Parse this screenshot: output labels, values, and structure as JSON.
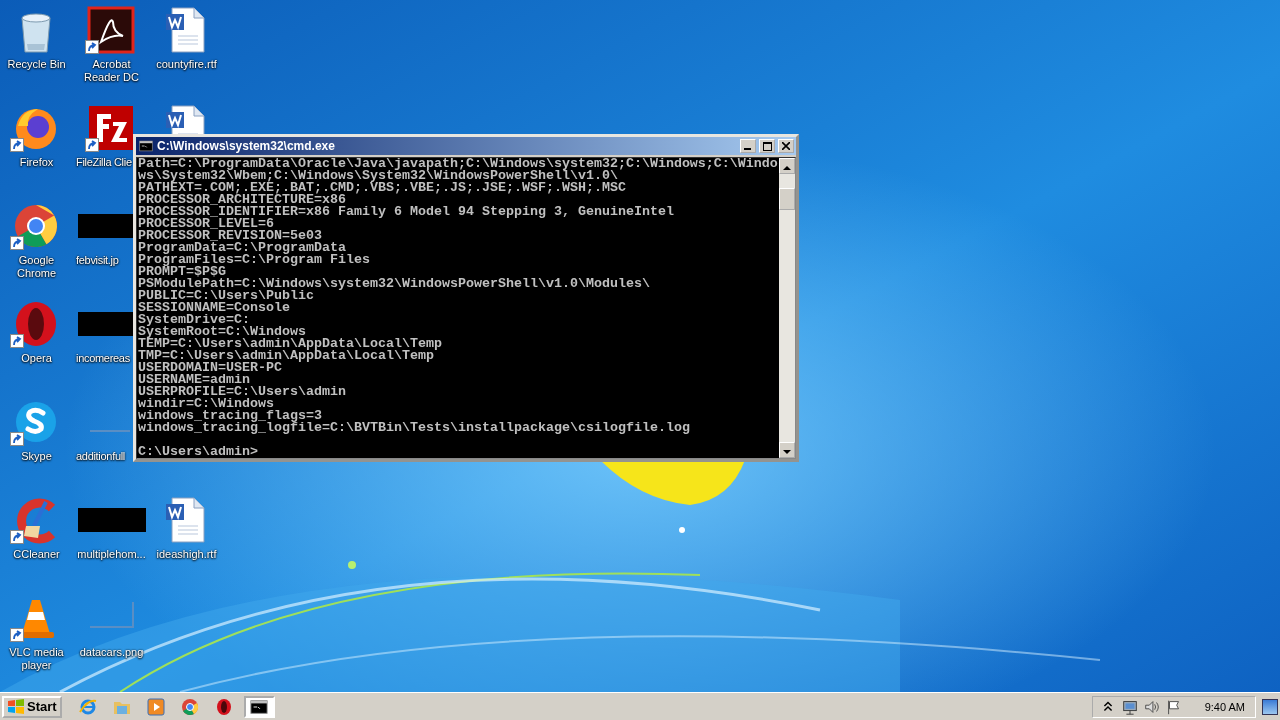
{
  "desktop": {
    "icon_columns": [
      [
        {
          "label": "Recycle Bin",
          "kind": "recycle-bin",
          "shortcut": false
        },
        {
          "label": "Firefox",
          "kind": "firefox",
          "shortcut": true
        },
        {
          "label": "Google\nChrome",
          "kind": "chrome",
          "shortcut": true
        },
        {
          "label": "Opera",
          "kind": "opera",
          "shortcut": true
        },
        {
          "label": "Skype",
          "kind": "skype",
          "shortcut": true
        },
        {
          "label": "CCleaner",
          "kind": "ccleaner",
          "shortcut": true
        },
        {
          "label": "VLC media\nplayer",
          "kind": "vlc",
          "shortcut": true
        }
      ],
      [
        {
          "label": "Acrobat\nReader DC",
          "kind": "acrobat",
          "shortcut": true
        },
        {
          "label": "FileZilla Clie",
          "kind": "filezilla",
          "shortcut": true
        },
        {
          "label": "febvisit.jp",
          "kind": "dark-thumbnail",
          "shortcut": false
        },
        {
          "label": "incomereas",
          "kind": "dark-thumbnail",
          "shortcut": false
        },
        {
          "label": "additionfull",
          "kind": "blank-thumbnail",
          "shortcut": false
        },
        {
          "label": "multiplehom...",
          "kind": "dark-thumbnail",
          "shortcut": false
        },
        {
          "label": "datacars.png",
          "kind": "blank-thumbnail",
          "shortcut": false
        }
      ],
      [
        {
          "label": "countyfire.rtf",
          "kind": "word-doc",
          "shortcut": false
        },
        {
          "kind": "word-doc",
          "shortcut": false
        },
        {
          "label": "ideashigh.rtf",
          "kind": "word-doc",
          "shortcut": false
        }
      ]
    ]
  },
  "console_window": {
    "title": "C:\\Windows\\system32\\cmd.exe",
    "lines": [
      "Path=C:\\ProgramData\\Oracle\\Java\\javapath;C:\\Windows\\system32;C:\\Windows;C:\\Windo",
      "ws\\System32\\Wbem;C:\\Windows\\System32\\WindowsPowerShell\\v1.0\\",
      "PATHEXT=.COM;.EXE;.BAT;.CMD;.VBS;.VBE;.JS;.JSE;.WSF;.WSH;.MSC",
      "PROCESSOR_ARCHITECTURE=x86",
      "PROCESSOR_IDENTIFIER=x86 Family 6 Model 94 Stepping 3, GenuineIntel",
      "PROCESSOR_LEVEL=6",
      "PROCESSOR_REVISION=5e03",
      "ProgramData=C:\\ProgramData",
      "ProgramFiles=C:\\Program Files",
      "PROMPT=$P$G",
      "PSModulePath=C:\\Windows\\system32\\WindowsPowerShell\\v1.0\\Modules\\",
      "PUBLIC=C:\\Users\\Public",
      "SESSIONNAME=Console",
      "SystemDrive=C:",
      "SystemRoot=C:\\Windows",
      "TEMP=C:\\Users\\admin\\AppData\\Local\\Temp",
      "TMP=C:\\Users\\admin\\AppData\\Local\\Temp",
      "USERDOMAIN=USER-PC",
      "USERNAME=admin",
      "USERPROFILE=C:\\Users\\admin",
      "windir=C:\\Windows",
      "windows_tracing_flags=3",
      "windows_tracing_logfile=C:\\BVTBin\\Tests\\installpackage\\csilogfile.log"
    ],
    "prompt": "C:\\Users\\admin>"
  },
  "taskbar": {
    "start_label": "Start",
    "pinned": [
      {
        "kind": "ie"
      },
      {
        "kind": "explorer"
      },
      {
        "kind": "media-player"
      },
      {
        "kind": "chrome"
      },
      {
        "kind": "opera"
      }
    ],
    "tasks": [
      {
        "kind": "console",
        "selected": true
      }
    ],
    "tray": [
      {
        "kind": "chevron"
      },
      {
        "kind": "network"
      },
      {
        "kind": "volume"
      },
      {
        "kind": "flag"
      }
    ],
    "time": "9:40 AM"
  }
}
